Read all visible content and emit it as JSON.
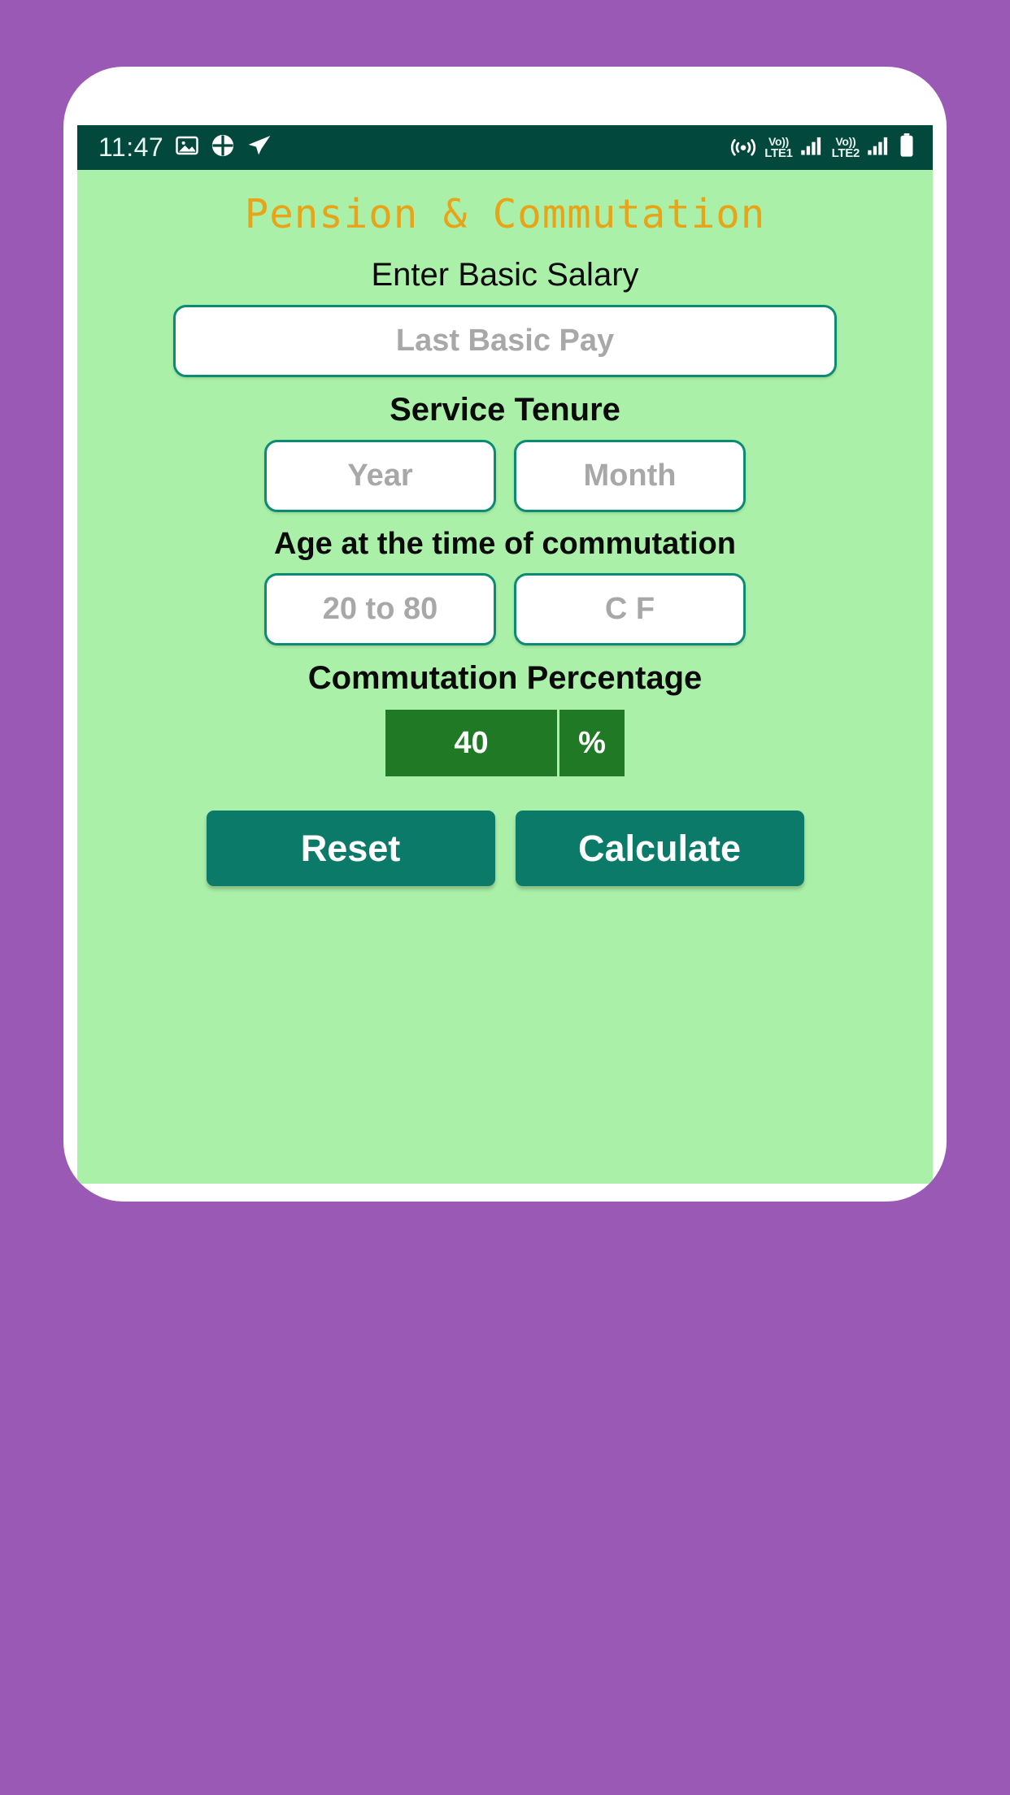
{
  "wallpaper": {
    "color": "#9b59b6"
  },
  "status_bar": {
    "time": "11:47",
    "background": "#02483c",
    "left_icons": [
      "gallery-icon",
      "clover-app-icon",
      "telegram-send-icon"
    ],
    "right_icons": [
      "hotspot-icon",
      "battery-icon"
    ],
    "sim1": {
      "top": "Vo))",
      "bottom": "LTE1",
      "signal": "signal-bars-icon"
    },
    "sim2": {
      "top": "Vo))",
      "bottom": "LTE2",
      "signal": "signal-bars-icon"
    }
  },
  "app": {
    "title": "Pension & Commutation",
    "title_color": "#e8a317",
    "background": "#aaf0a8",
    "accent": "#0b7a68",
    "sections": {
      "salary": {
        "label": "Enter Basic Salary",
        "input": {
          "value": "",
          "placeholder": "Last Basic Pay"
        }
      },
      "tenure": {
        "label": "Service Tenure",
        "year": {
          "value": "",
          "placeholder": "Year"
        },
        "month": {
          "value": "",
          "placeholder": "Month"
        }
      },
      "age": {
        "label": "Age at the time of commutation",
        "age_input": {
          "value": "",
          "placeholder": "20 to 80"
        },
        "cf_input": {
          "value": "",
          "placeholder": "C F"
        }
      },
      "commutation": {
        "label": "Commutation Percentage",
        "value": "40",
        "symbol": "%",
        "box_color": "#207a25"
      }
    },
    "buttons": {
      "reset": "Reset",
      "calculate": "Calculate"
    }
  },
  "nav_bar": {
    "recents": "recents-icon",
    "home": "home-icon",
    "back": "back-icon"
  }
}
